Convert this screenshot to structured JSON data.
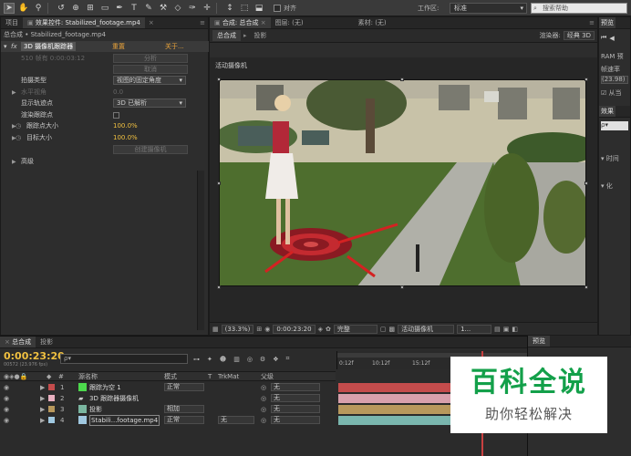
{
  "toolbar": {
    "tools": [
      "✋",
      "🔍",
      "↻",
      "⊞",
      "▢",
      "✎",
      "T",
      "✒",
      "⚒",
      "◆",
      "✑",
      "✛"
    ],
    "align_label": "对齐",
    "workspace_label": "工作区:",
    "workspace_value": "标准",
    "search_placeholder": "搜索帮助"
  },
  "effect_panel": {
    "tab_project": "项目",
    "tab_effects": "效果控件: Stabilized_footage.mp4",
    "breadcrumb": "总合成 • Stabilized_footage.mp4",
    "effect_name": "3D 摄像机跟踪器",
    "reset": "重置",
    "about": "关于...",
    "status_text": "510 帧有 0:00:03:12",
    "btn_analyze": "分析",
    "btn_cancel": "取消",
    "shot_type_label": "拍摄类型",
    "shot_type_value": "视图的固定角度",
    "hfov_label": "水平视角",
    "hfov_value": "0.0",
    "show_track_label": "显示轨迹点",
    "show_track_value": "3D 已解析",
    "render_track_label": "渲染跟踪点",
    "track_size_label": "跟踪点大小",
    "track_size_value": "100.0%",
    "target_size_label": "目标大小",
    "target_size_value": "100.0%",
    "btn_create_camera": "创建摄像机",
    "advanced_label": "高级"
  },
  "comp_panel": {
    "tab_comp": "合成: 总合成",
    "tab_layer": "图层: (无)",
    "tab_footage": "素材: (无)",
    "sub_tab_main": "总合成",
    "sub_tab_shadow": "投影",
    "renderer_label": "渲染器:",
    "renderer_value": "经典 3D",
    "active_camera": "活动摄像机",
    "zoom": "(33.3%)",
    "timecode": "0:00:23:20",
    "quality": "完整",
    "view_camera": "活动摄像机",
    "views": "1..."
  },
  "right_panel": {
    "tab": "预览",
    "ram_label": "RAM 预",
    "framerate_label": "帧速率",
    "framerate_value": "(23.98)",
    "from_label": "从当",
    "effects_tab": "效果",
    "time_label": "时间",
    "transition_label": "化"
  },
  "timeline": {
    "tab_main": "总合成",
    "tab_shadow": "投影",
    "timecode": "0:00:23:20",
    "frame_info": "00572 (23.976 fps)",
    "search_placeholder": "ρ▾",
    "col_name": "源名称",
    "col_mode": "模式",
    "col_t": "T",
    "col_trkmat": "TrkMat",
    "col_parent": "父级",
    "ruler": [
      "0:12f",
      "10:12f",
      "15:12f"
    ],
    "layers": [
      {
        "num": "1",
        "name": "跟踪为空 1",
        "mode": "正常",
        "trkmat": "",
        "parent": "无",
        "color": "#c44c4c",
        "swatch": "#4cd94c"
      },
      {
        "num": "2",
        "name": "3D 跟踪器摄像机",
        "mode": "",
        "trkmat": "",
        "parent": "无",
        "color": "#d8a0ac",
        "swatch": "#e8b0c0"
      },
      {
        "num": "3",
        "name": "投影",
        "mode": "相加",
        "trkmat": "",
        "parent": "无",
        "color": "#b8985c",
        "swatch": "#7ab6a0"
      },
      {
        "num": "4",
        "name": "Stabili...footage.mp4",
        "mode": "正常",
        "trkmat": "无",
        "parent": "无",
        "color": "#7ab6ae",
        "swatch": "#a0c8e0"
      }
    ]
  },
  "preview_panel": {
    "tab": "预览"
  },
  "watermark": {
    "title": "百科全说",
    "subtitle": "助你轻松解决"
  }
}
